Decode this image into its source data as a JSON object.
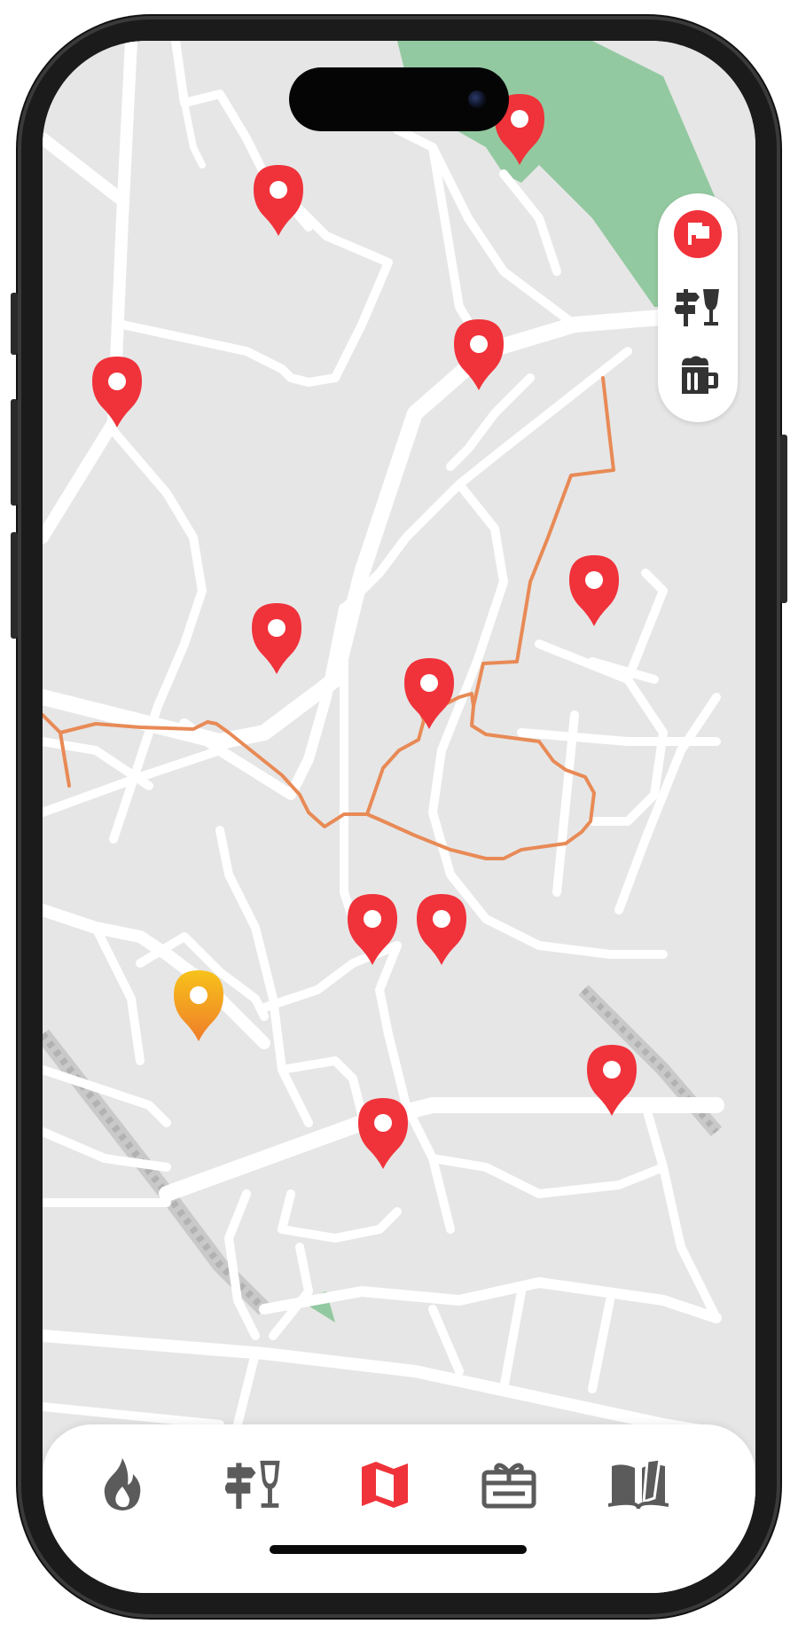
{
  "app": {
    "screen": "map"
  },
  "colors": {
    "accent": "#f0323a",
    "inactive_icon": "#5b5b5b",
    "map_background": "#e6e6e6",
    "road": "#ffffff",
    "park": "#93c9a0",
    "route": "#e88a56",
    "pin_default": "#f0323a",
    "pin_highlight": "#f5a623"
  },
  "map": {
    "route_visible": true,
    "pins": [
      {
        "kind": "default"
      },
      {
        "kind": "default"
      },
      {
        "kind": "default"
      },
      {
        "kind": "default"
      },
      {
        "kind": "default"
      },
      {
        "kind": "default"
      },
      {
        "kind": "default"
      },
      {
        "kind": "default"
      },
      {
        "kind": "default"
      },
      {
        "kind": "highlight"
      },
      {
        "kind": "default"
      },
      {
        "kind": "default"
      }
    ]
  },
  "map_filter": {
    "buttons": [
      {
        "icon": "flag-icon",
        "selected": true
      },
      {
        "icon": "signpost-glass-icon",
        "selected": false
      },
      {
        "icon": "beer-mug-icon",
        "selected": false
      }
    ]
  },
  "tab_bar": {
    "tabs": [
      {
        "icon": "flame-icon",
        "selected": false
      },
      {
        "icon": "signpost-glass-icon",
        "selected": false
      },
      {
        "icon": "map-icon",
        "selected": true
      },
      {
        "icon": "gift-card-icon",
        "selected": false
      },
      {
        "icon": "open-book-icon",
        "selected": false
      }
    ]
  }
}
